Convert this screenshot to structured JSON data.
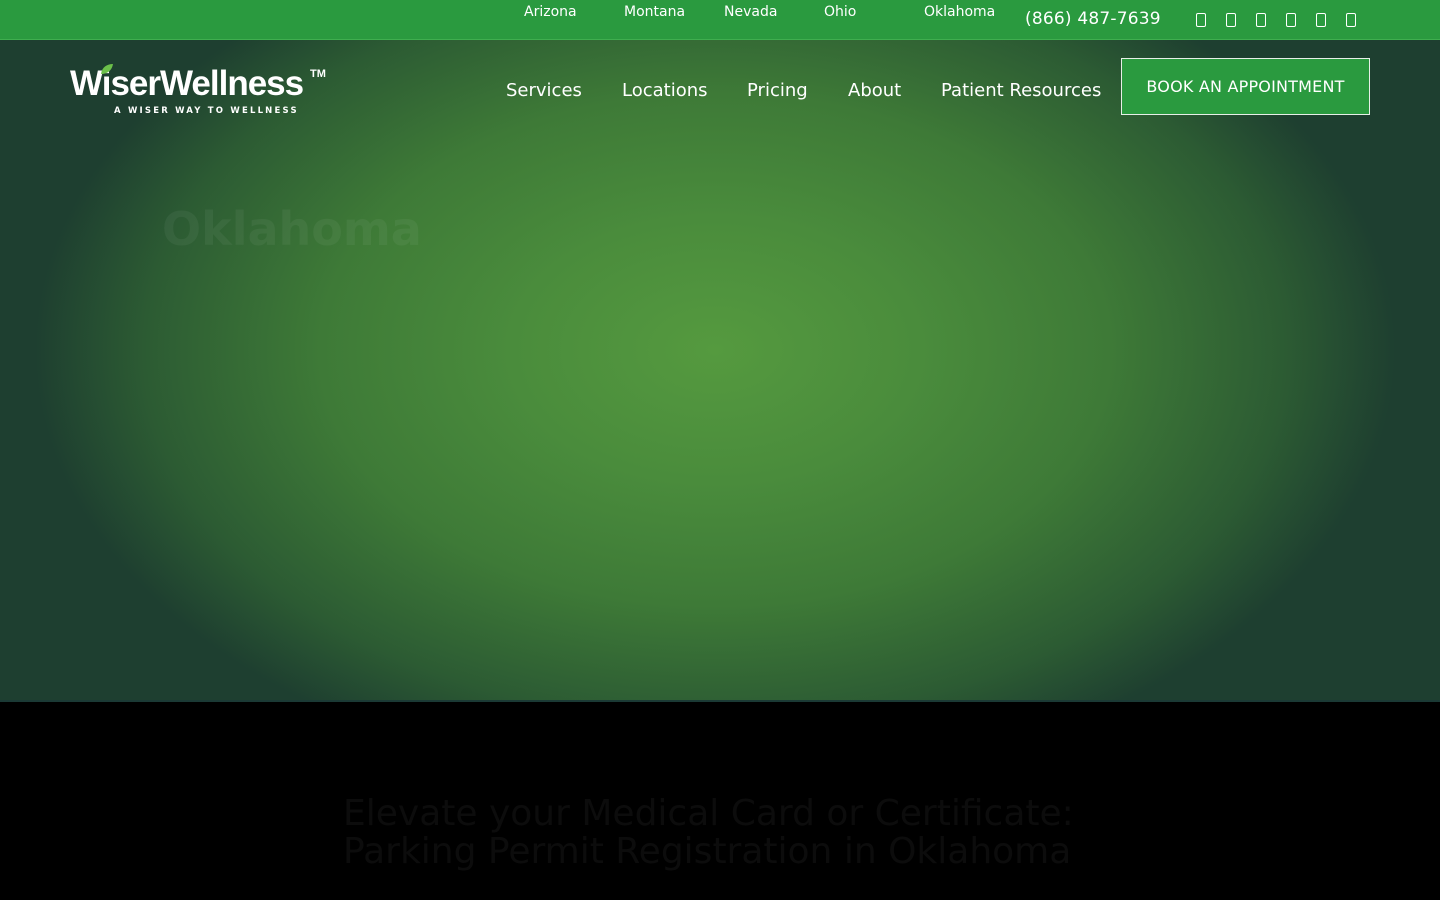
{
  "topbar": {
    "states": [
      "Arizona",
      "Montana",
      "Nevada",
      "Ohio",
      "Oklahoma"
    ],
    "phone": "(866) 487-7639",
    "social_icons": [
      "facebook-icon",
      "instagram-icon",
      "twitter-icon",
      "youtube-icon",
      "linkedin-icon",
      "tiktok-icon"
    ]
  },
  "logo": {
    "wordmark": "WiserWellness",
    "tm": "TM",
    "tagline": "A WISER WAY TO WELLNESS"
  },
  "nav": {
    "items": [
      "Services",
      "Locations",
      "Pricing",
      "About",
      "Patient Resources"
    ],
    "cta": "BOOK AN APPOINTMENT"
  },
  "hero": {
    "title": "Oklahoma"
  },
  "section": {
    "heading": "Elevate your Medical Card or Certificate: Parking Permit Registration in Oklahoma"
  },
  "colors": {
    "brand_green": "#2a9a3f",
    "hero_center": "#559a3f",
    "hero_edge": "#1e3f30"
  }
}
